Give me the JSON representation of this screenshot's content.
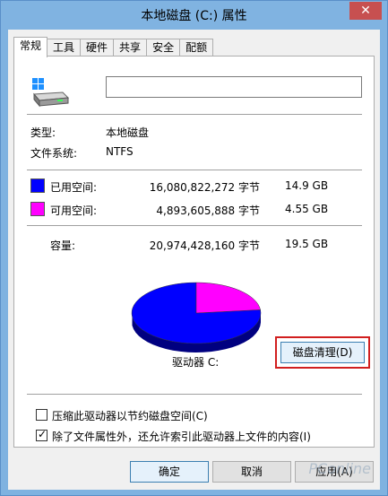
{
  "window": {
    "title": "本地磁盘 (C:) 属性",
    "close_glyph": "✕"
  },
  "tabs": [
    {
      "label": "常规",
      "active": true
    },
    {
      "label": "工具"
    },
    {
      "label": "硬件"
    },
    {
      "label": "共享"
    },
    {
      "label": "安全"
    },
    {
      "label": "配额"
    }
  ],
  "general": {
    "name_value": "",
    "type_label": "类型:",
    "type_value": "本地磁盘",
    "fs_label": "文件系统:",
    "fs_value": "NTFS",
    "used": {
      "label": "已用空间:",
      "bytes": "16,080,822,272 字节",
      "size": "14.9 GB",
      "color": "#0000ff"
    },
    "free": {
      "label": "可用空间:",
      "bytes": "4,893,605,888 字节",
      "size": "4.55 GB",
      "color": "#ff00ff"
    },
    "capacity": {
      "label": "容量:",
      "bytes": "20,974,428,160 字节",
      "size": "19.5 GB"
    },
    "drive_label": "驱动器 C:",
    "cleanup_button": "磁盘清理(D)",
    "compress_checkbox": {
      "label": "压缩此驱动器以节约磁盘空间(C)",
      "checked": false
    },
    "index_checkbox": {
      "label": "除了文件属性外，还允许索引此驱动器上文件的内容(I)",
      "checked": true,
      "mark": "✓"
    }
  },
  "buttons": {
    "ok": "确定",
    "cancel": "取消",
    "apply": "应用(A)"
  },
  "watermark": "PConline",
  "chart_data": {
    "type": "pie",
    "categories": [
      "已用空间",
      "可用空间"
    ],
    "values": [
      16080822272,
      4893605888
    ],
    "colors": [
      "#0000ff",
      "#ff00ff"
    ]
  }
}
